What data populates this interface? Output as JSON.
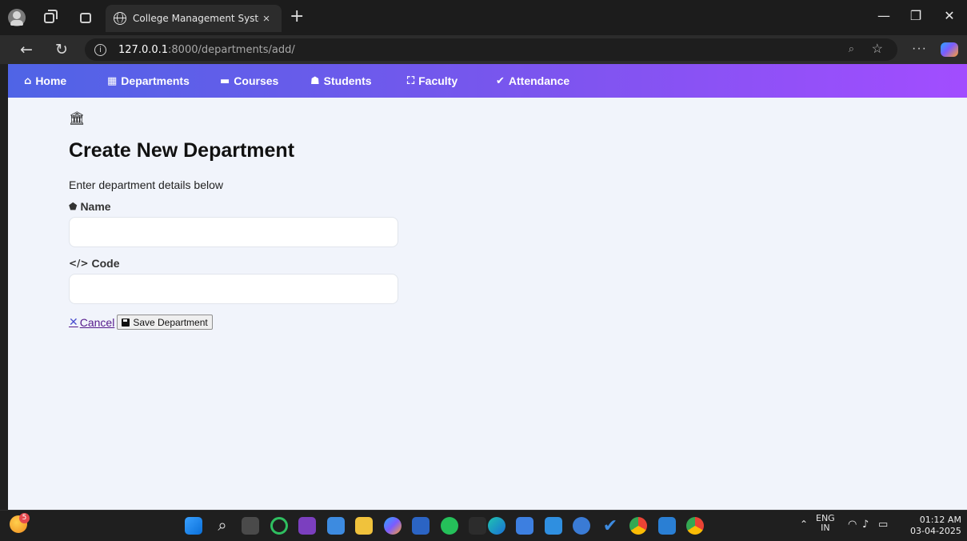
{
  "browser": {
    "tab_title": "College Management System",
    "tab_close": "×",
    "new_tab": "+",
    "url_host": "127.0.0.1",
    "url_path": ":8000/departments/add/",
    "more": "···",
    "minimize": "—",
    "restore": "❐",
    "close": "✕"
  },
  "nav": {
    "items": [
      {
        "icon": "home-icon",
        "glyph": "⌂",
        "label": "Home"
      },
      {
        "icon": "building-icon",
        "glyph": "▦",
        "label": "Departments"
      },
      {
        "icon": "book-icon",
        "glyph": "▬",
        "label": "Courses"
      },
      {
        "icon": "graduate-icon",
        "glyph": "☗",
        "label": "Students"
      },
      {
        "icon": "teacher-icon",
        "glyph": "⛶",
        "label": "Faculty"
      },
      {
        "icon": "clipboard-check-icon",
        "glyph": "✔",
        "label": "Attendance"
      }
    ]
  },
  "form": {
    "header_glyph": "🏛",
    "title": "Create New Department",
    "subtitle": "Enter department details below",
    "name_label": "Name",
    "name_value": "",
    "code_label": "Code",
    "code_icon": "</>",
    "code_value": "",
    "cancel_label": "Cancel",
    "save_label": "Save Department"
  },
  "taskbar": {
    "weather_badge": "5",
    "lang_top": "ENG",
    "lang_bottom": "IN",
    "time": "01:12 AM",
    "date": "03-04-2025"
  },
  "colors": {
    "nav_gradient_start": "#4f64e6",
    "nav_gradient_end": "#a24dff",
    "page_bg": "#f1f4fb"
  }
}
